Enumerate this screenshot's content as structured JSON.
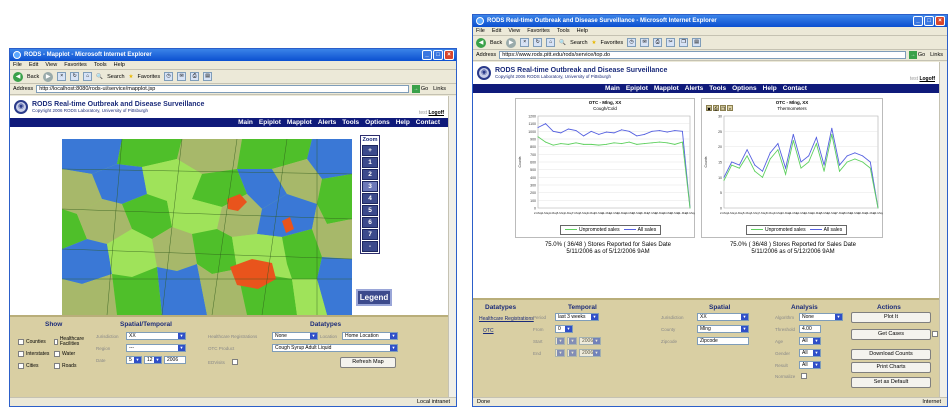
{
  "heading": "",
  "left": {
    "window_title": "RODS - Mapplot - Microsoft Internet Explorer",
    "menu": [
      "File",
      "Edit",
      "View",
      "Favorites",
      "Tools",
      "Help"
    ],
    "toolbar": {
      "back": "Back",
      "search": "Search",
      "favorites": "Favorites"
    },
    "address_label": "Address",
    "address": "http://localhost:8080/rods-ui/service/mapplot.jsp",
    "go": "Go",
    "links": "Links",
    "site_title": "RODS Real-time Outbreak and Disease Surveillance",
    "copyright": "Copyright 2006 RODS Laboratory, University of Pittsburgh",
    "user": "test",
    "logoff": "Logoff",
    "nav": [
      "Main",
      "Epiplot",
      "Mapplot",
      "Alerts",
      "Tools",
      "Options",
      "Help",
      "Contact"
    ],
    "zoom": {
      "label": "Zoom",
      "buttons": [
        "+",
        "1",
        "2",
        "3",
        "4",
        "5",
        "6",
        "7",
        "-"
      ],
      "active": "3"
    },
    "legend_button": "Legend",
    "show": {
      "title": "Show",
      "checkboxes": [
        "Counties",
        "Healthcare Facilities",
        "Interstates",
        "Water",
        "Cities",
        "Roads"
      ]
    },
    "spatial": {
      "title": "Spatial/Temporal",
      "jurisdiction_label": "Jurisdiction",
      "jurisdiction": "XX",
      "region_label": "Region",
      "region": "---",
      "date_label": "Date",
      "month": "5",
      "day": "12",
      "year": "2006"
    },
    "datatypes": {
      "title": "Datatypes",
      "hr_label": "Healthcare Registrations",
      "hr_value": "None",
      "location_label": "Location",
      "location_value": "Home Location",
      "otc_label": "OTC Product",
      "otc_value": "Cough Syrup Adult Liquid",
      "ed_label": "EDVisits",
      "refresh": "Refresh Map"
    },
    "status_zone": "Local intranet",
    "colors": {
      "light": "#9fe35a",
      "mid": "#4fbf2a",
      "dark": "#a7b86a",
      "water": "#3a78d6",
      "alert": "#e9541c"
    }
  },
  "right": {
    "window_title": "RODS Real-time Outbreak and Disease Surveillance - Microsoft Internet Explorer",
    "menu": [
      "File",
      "Edit",
      "View",
      "Favorites",
      "Tools",
      "Help"
    ],
    "toolbar": {
      "back": "Back",
      "search": "Search",
      "favorites": "Favorites"
    },
    "address_label": "Address",
    "address": "https://www.rods.pitt.edu/rods/service/top.do",
    "go": "Go",
    "links": "Links",
    "site_title": "RODS Real-time Outbreak and Disease Surveillance",
    "copyright": "Copyright 2006 RODS Laboratory, University of Pittsburgh",
    "user": "test",
    "logoff": "Logoff",
    "nav": [
      "Main",
      "Epiplot",
      "Mapplot",
      "Alerts",
      "Tools",
      "Options",
      "Help",
      "Contact"
    ],
    "stats": [
      {
        "line1": "75.0% ( 36/48 ) Stores Reported for Sales Date",
        "line2": "5/11/2006 as of 5/12/2006 9AM"
      },
      {
        "line1": "75.0% ( 36/48 ) Stores Reported for Sales Date",
        "line2": "5/11/2006 as of 5/12/2006 9AM"
      }
    ],
    "panel": {
      "datatypes_title": "Datatypes",
      "hr_link": "Healthcare Registrations",
      "otc_link": "OTC",
      "temporal_title": "Temporal",
      "period_label": "Period",
      "period": "last 3 weeks",
      "from_label": "From",
      "from": "0",
      "start_label": "Start",
      "end_label": "End",
      "start_year": "2006",
      "end_year": "2006",
      "spatial_title": "Spatial",
      "jurisdiction_label": "Jurisdiction",
      "jurisdiction": "XX",
      "county_label": "County",
      "county": "Mlng",
      "zipcode_label": "Zipcode",
      "zipcode": "Zipcode",
      "analysis_title": "Analysis",
      "algorithm_label": "Algorithm",
      "algorithm": "None",
      "threshold_label": "Threshold",
      "threshold": "4.00",
      "age_label": "Age",
      "age": "All",
      "gender_label": "Gender",
      "gender": "All",
      "result_label": "Result",
      "result": "All",
      "normalize_label": "Normalize",
      "actions_title": "Actions",
      "actions": [
        "Plot It",
        "Get Cases",
        "Download Counts",
        "Print Charts",
        "Set as Default"
      ]
    },
    "status_left": "Done",
    "status_zone": "Internet"
  },
  "chart_data": [
    {
      "type": "line",
      "title": "OTC - Mlng, XX",
      "subtitle": "Cough/Cold",
      "ylabel": "Counts",
      "categories": [
        "2-May",
        "3-May",
        "4-May",
        "5-May",
        "6-May",
        "7-May",
        "8-May",
        "9-May",
        "10-May",
        "11-May",
        "12-May",
        "13-May",
        "14-May",
        "15-May",
        "16-May",
        "17-May",
        "18-May",
        "19-May",
        "20-May",
        "21-May",
        "22-May"
      ],
      "ylim": [
        0,
        1200
      ],
      "yticks": [
        "0",
        "100",
        "200",
        "300",
        "400",
        "500",
        "600",
        "700",
        "800",
        "900",
        "1000",
        "1100",
        "1200"
      ],
      "series": [
        {
          "name": "All sales",
          "color": "#5560e0",
          "values": [
            1050,
            1100,
            1000,
            980,
            1030,
            1010,
            940,
            1000,
            960,
            990,
            980,
            1020,
            1000,
            940,
            960,
            1000,
            1010,
            990,
            1010,
            1000,
            0
          ]
        },
        {
          "name": "Unpromoted sales",
          "color": "#5fd05f",
          "values": [
            930,
            860,
            820,
            840,
            830,
            850,
            830,
            830,
            820,
            830,
            850,
            840,
            860,
            830,
            840,
            850,
            860,
            850,
            830,
            860,
            0
          ]
        }
      ],
      "legend": "bottom"
    },
    {
      "type": "line",
      "title": "OTC - Mlng, XX",
      "subtitle": "Thermometers",
      "ylabel": "Counts",
      "categories": [
        "2-May",
        "3-May",
        "4-May",
        "5-May",
        "6-May",
        "7-May",
        "8-May",
        "9-May",
        "10-May",
        "11-May",
        "12-May",
        "13-May",
        "14-May",
        "15-May",
        "16-May",
        "17-May",
        "18-May",
        "19-May",
        "20-May",
        "21-May",
        "22-May"
      ],
      "ylim": [
        0,
        30
      ],
      "yticks": [
        "0",
        "5",
        "10",
        "15",
        "20",
        "25",
        "30"
      ],
      "series": [
        {
          "name": "All sales",
          "color": "#5560e0",
          "values": [
            10,
            15,
            14,
            19,
            14,
            12,
            18,
            21,
            13,
            24,
            15,
            17,
            23,
            14,
            26,
            14,
            17,
            18,
            17,
            15,
            0
          ]
        },
        {
          "name": "Unpromoted sales",
          "color": "#5fd05f",
          "values": [
            9,
            14,
            13,
            17,
            12,
            10,
            16,
            19,
            11,
            22,
            13,
            15,
            21,
            12,
            24,
            12,
            15,
            16,
            15,
            13,
            0
          ]
        }
      ],
      "legend": "bottom"
    }
  ]
}
